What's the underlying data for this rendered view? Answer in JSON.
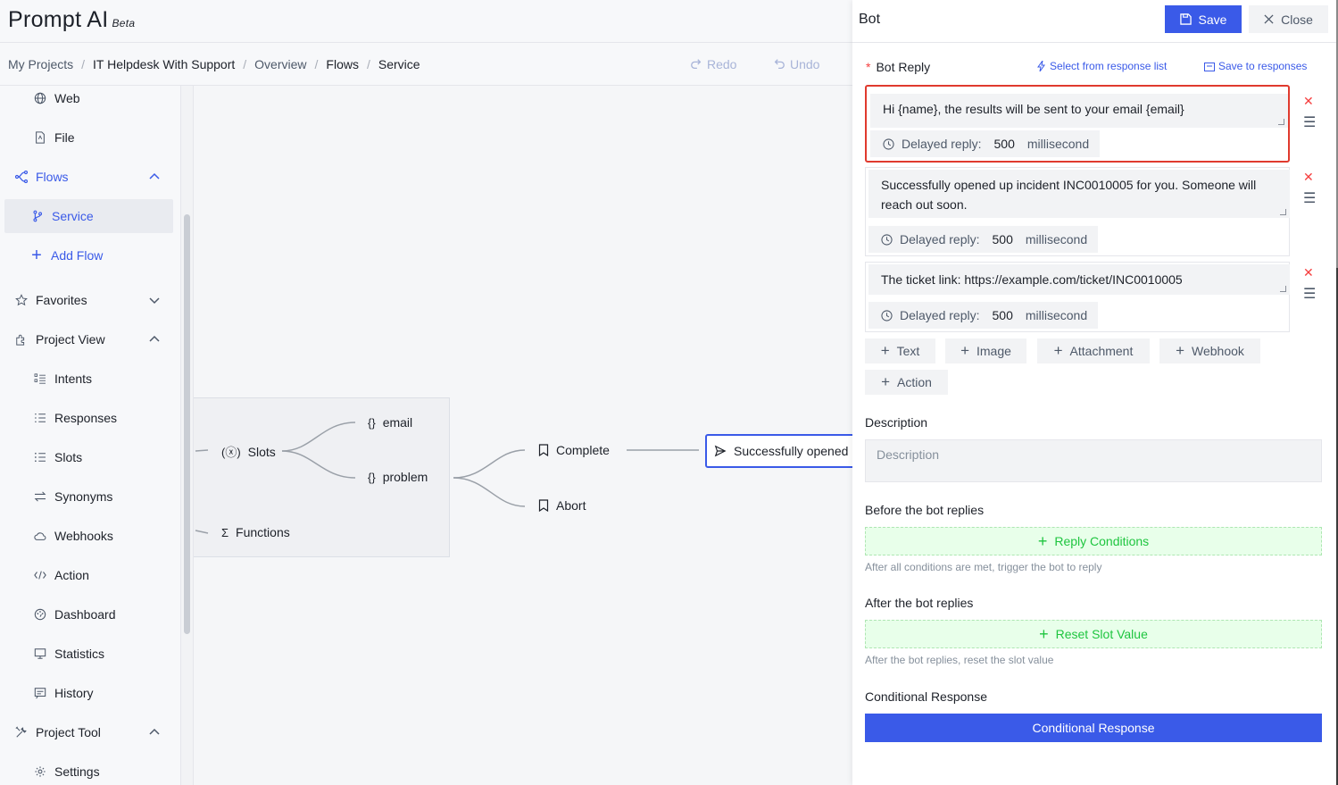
{
  "brand": {
    "name": "Prompt AI",
    "badge": "Beta"
  },
  "breadcrumb": {
    "items": [
      "My Projects",
      "IT Helpdesk With Support",
      "Overview",
      "Flows",
      "Service"
    ],
    "separator": "/"
  },
  "history": {
    "redo": "Redo",
    "undo": "Undo"
  },
  "sidebar": {
    "web": "Web",
    "file": "File",
    "flows": "Flows",
    "service": "Service",
    "add_flow": "Add Flow",
    "favorites": "Favorites",
    "project_view": "Project View",
    "intents": "Intents",
    "responses": "Responses",
    "slots": "Slots",
    "synonyms": "Synonyms",
    "webhooks": "Webhooks",
    "action": "Action",
    "dashboard": "Dashboard",
    "statistics": "Statistics",
    "history": "History",
    "project_tool": "Project Tool",
    "settings": "Settings"
  },
  "canvas": {
    "slots": "Slots",
    "email": "email",
    "problem": "problem",
    "functions": "Functions",
    "complete": "Complete",
    "abort": "Abort",
    "selected_node": "Successfully opened"
  },
  "panel": {
    "title": "Bot",
    "save": "Save",
    "close": "Close",
    "bot_reply_label": "Bot Reply",
    "required_mark": "*",
    "select_from_list": "Select from response list",
    "save_to_responses": "Save to responses",
    "delay_label": "Delayed reply:",
    "delay_unit": "millisecond",
    "replies": [
      {
        "text": "Hi {name},  the results will be sent to your email {email}",
        "delay": "500"
      },
      {
        "text": "Successfully opened up incident INC0010005 for you. Someone will reach out soon.",
        "delay": "500"
      },
      {
        "text": "The ticket link: https://example.com/ticket/INC0010005",
        "delay": "500"
      }
    ],
    "add_buttons": {
      "text": "Text",
      "image": "Image",
      "attachment": "Attachment",
      "webhook": "Webhook",
      "action": "Action"
    },
    "description_label": "Description",
    "description_placeholder": "Description",
    "before_label": "Before the bot replies",
    "reply_conditions": "Reply Conditions",
    "before_hint": "After all conditions are met, trigger the bot to reply",
    "after_label": "After the bot replies",
    "reset_slot": "Reset Slot Value",
    "after_hint": "After the bot replies, reset the slot value",
    "conditional_label": "Conditional Response",
    "conditional_button": "Conditional Response"
  },
  "colors": {
    "accent": "#3a5ae8",
    "highlight": "#e03a2e",
    "delete": "#f53f3f",
    "success": "#1ec53f"
  }
}
